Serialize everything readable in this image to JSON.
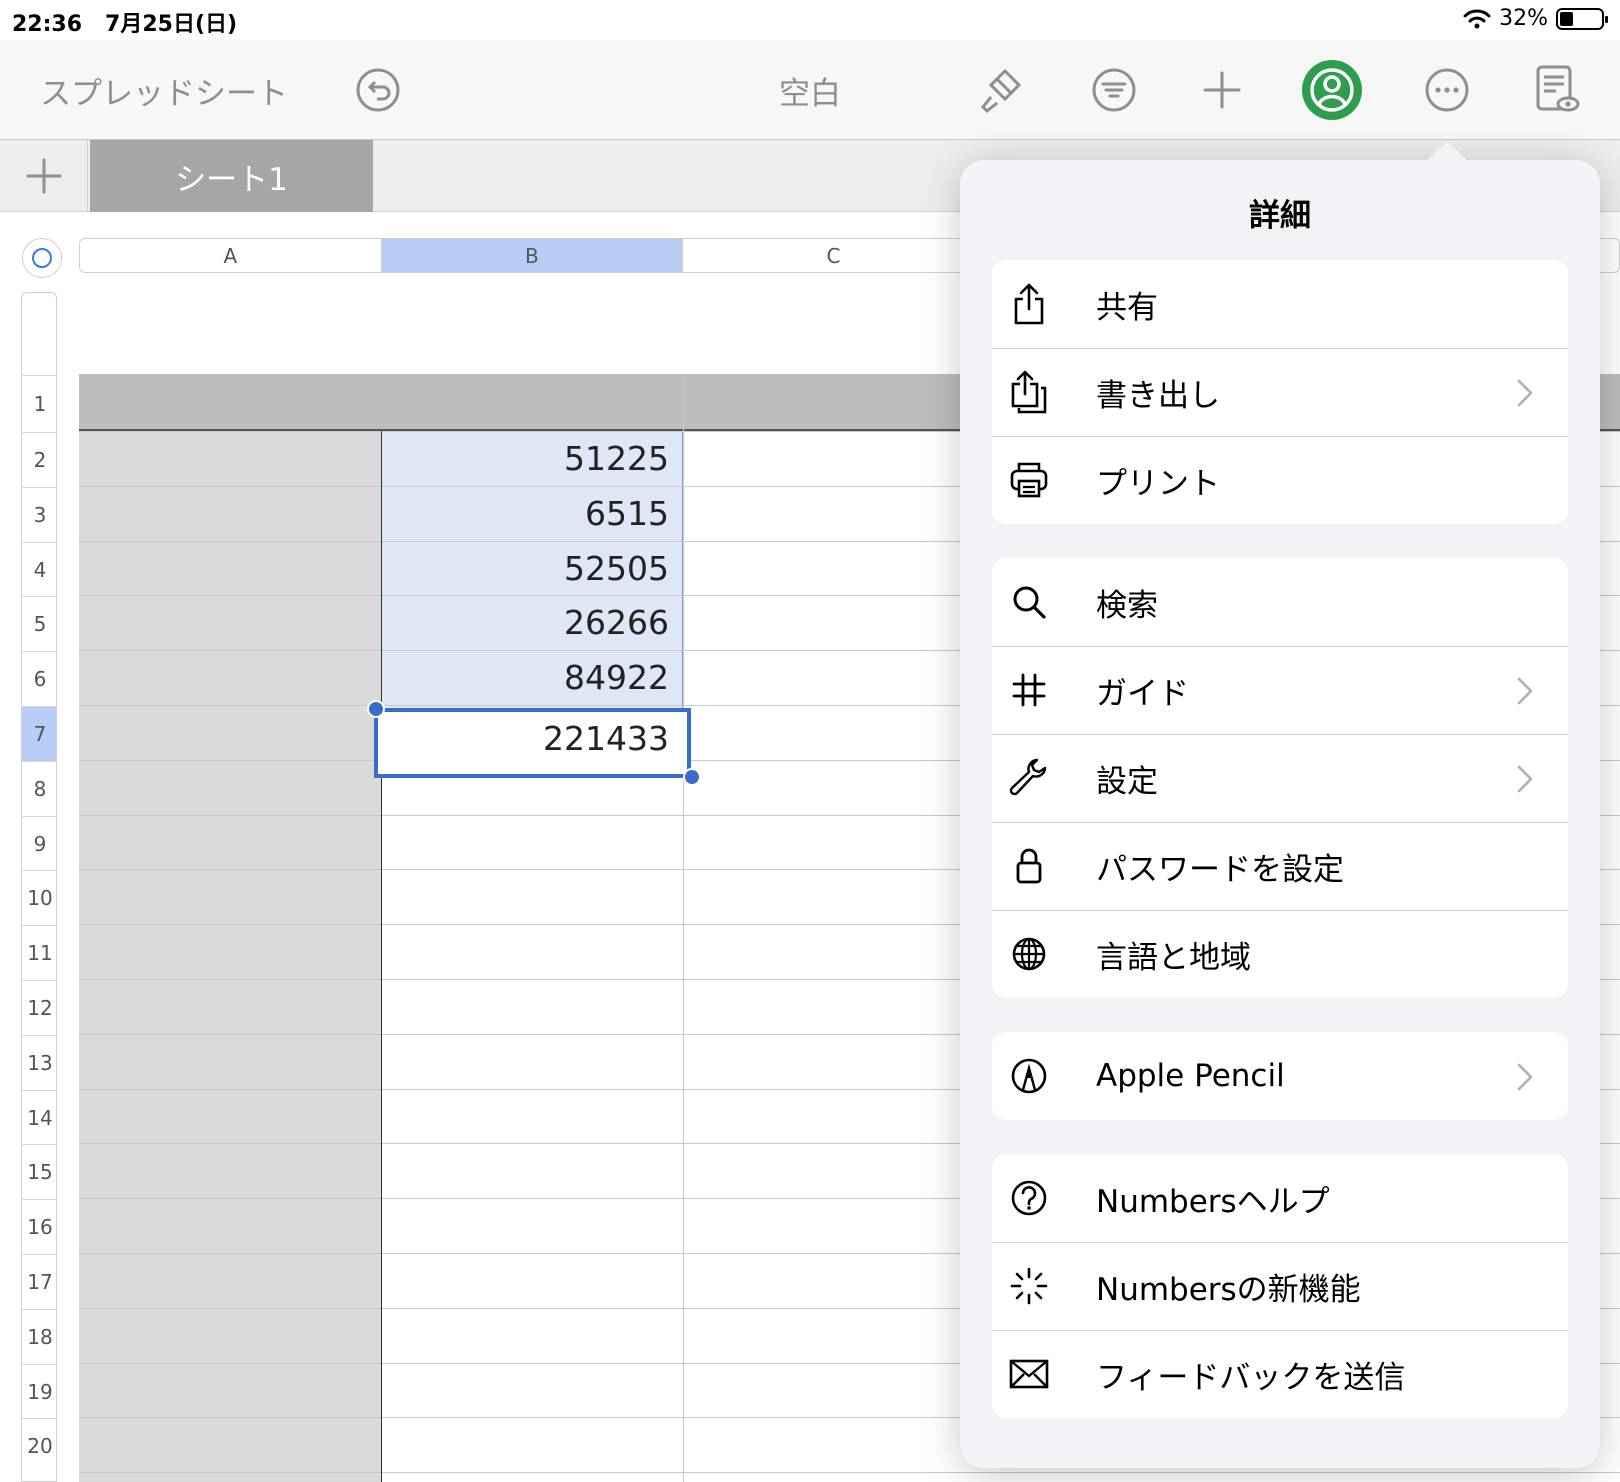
{
  "status": {
    "time": "22:36",
    "date": "7月25日(日)",
    "battery": "32%",
    "battery_level": 0.32
  },
  "toolbar": {
    "back_label": "スプレッドシート",
    "title": "空白",
    "icons": [
      "undo-icon",
      "paintbrush-icon",
      "filter-icon",
      "plus-icon",
      "collaborate-icon",
      "more-icon",
      "reader-view-icon"
    ]
  },
  "tabs": {
    "add_icon": "plus-icon",
    "sheet_name": "シート1"
  },
  "columns": [
    "A",
    "B",
    "C"
  ],
  "rows": [
    "1",
    "2",
    "3",
    "4",
    "5",
    "6",
    "7",
    "8",
    "9",
    "10",
    "11",
    "12",
    "13",
    "14",
    "15",
    "16",
    "17",
    "18",
    "19",
    "20"
  ],
  "cells": {
    "B2": "51225",
    "B3": "6515",
    "B4": "52505",
    "B5": "26266",
    "B6": "84922",
    "B7": "221433"
  },
  "selected": {
    "column": "B",
    "row": "7"
  },
  "menu": {
    "title": "詳細",
    "groups": [
      [
        {
          "label": "共有",
          "icon": "share-icon",
          "chevron": false
        },
        {
          "label": "書き出し",
          "icon": "export-icon",
          "chevron": true
        },
        {
          "label": "プリント",
          "icon": "printer-icon",
          "chevron": false
        }
      ],
      [
        {
          "label": "検索",
          "icon": "search-icon",
          "chevron": false
        },
        {
          "label": "ガイド",
          "icon": "grid-hash-icon",
          "chevron": true
        },
        {
          "label": "設定",
          "icon": "wrench-icon",
          "chevron": true
        },
        {
          "label": "パスワードを設定",
          "icon": "lock-icon",
          "chevron": false
        },
        {
          "label": "言語と地域",
          "icon": "globe-icon",
          "chevron": false
        }
      ],
      [
        {
          "label": "Apple Pencil",
          "icon": "pencil-tip-icon",
          "chevron": true
        }
      ],
      [
        {
          "label": "Numbersヘルプ",
          "icon": "help-icon",
          "chevron": false
        },
        {
          "label": "Numbersの新機能",
          "icon": "sparkle-icon",
          "chevron": false
        },
        {
          "label": "フィードバックを送信",
          "icon": "mail-icon",
          "chevron": false
        }
      ]
    ]
  }
}
